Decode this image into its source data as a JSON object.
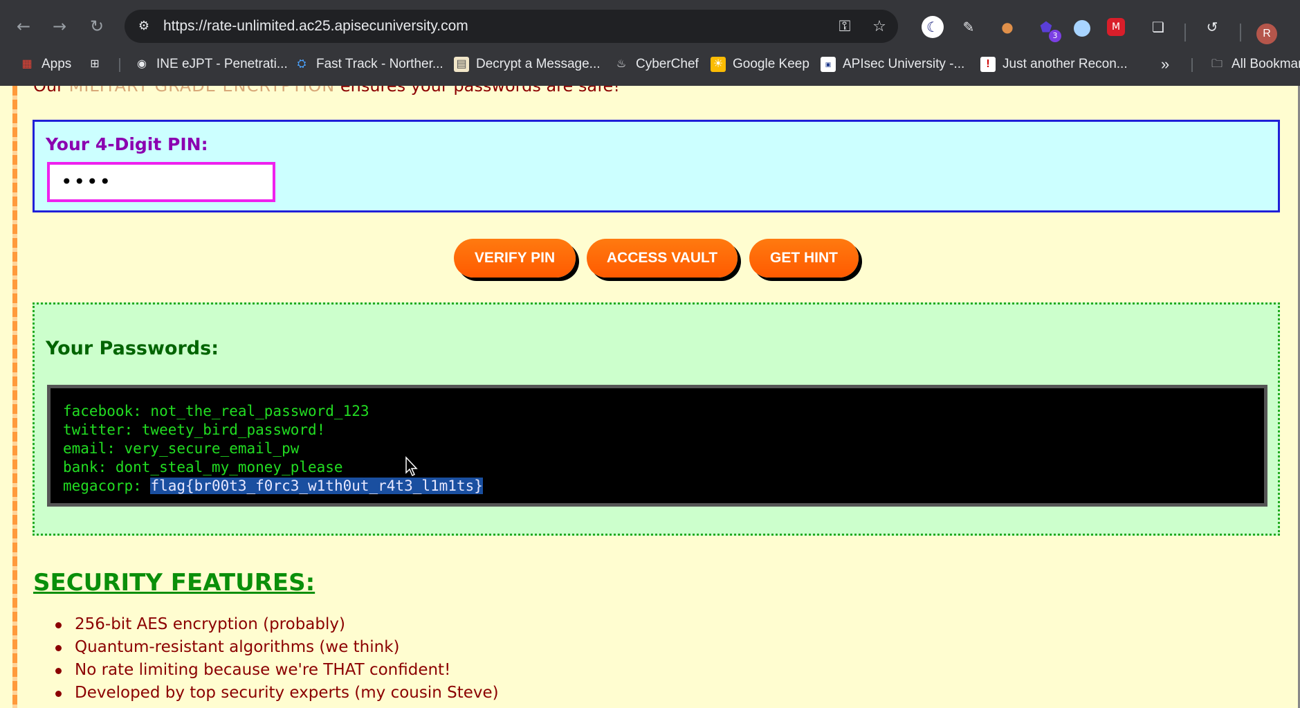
{
  "browser": {
    "url": "https://rate-unlimited.ac25.apisecuniversity.com",
    "extension_badge": "3",
    "avatar_letter": "R",
    "bookmarks": [
      {
        "label": "Apps",
        "icon": "apps-grid-icon"
      },
      {
        "label": "INE eJPT - Penetrati...",
        "icon": "globe-icon"
      },
      {
        "label": "Fast Track - Norther...",
        "icon": "gear-icon"
      },
      {
        "label": "Decrypt a Message...",
        "icon": "document-icon"
      },
      {
        "label": "CyberChef",
        "icon": "chef-hat-icon"
      },
      {
        "label": "Google Keep",
        "icon": "keep-icon"
      },
      {
        "label": "APIsec University -...",
        "icon": "apisec-icon"
      },
      {
        "label": "Just another Recon...",
        "icon": "exclamation-icon"
      }
    ],
    "all_bookmarks": "All Bookmar"
  },
  "page": {
    "intro_prefix": "Our ",
    "intro_highlight": "MILITARY GRADE ENCRYPTION",
    "intro_suffix": " ensures your passwords are safe!",
    "pin_label": "Your 4-Digit PIN:",
    "pin_value": "••••",
    "buttons": {
      "verify": "VERIFY PIN",
      "vault": "ACCESS VAULT",
      "hint": "GET HINT"
    },
    "passwords_title": "Your Passwords:",
    "passwords": [
      "facebook: not_the_real_password_123",
      "twitter: tweety_bird_password!",
      "email: very_secure_email_pw",
      "bank: dont_steal_my_money_please"
    ],
    "megacorp_label": "megacorp: ",
    "megacorp_value": "flag{br00t3_f0rc3_w1th0ut_r4t3_l1m1ts}",
    "security_title": "SECURITY FEATURES:",
    "features": [
      "256-bit AES encryption (probably)",
      "Quantum-resistant algorithms (we think)",
      "No rate limiting because we're THAT confident!",
      "Developed by top security experts (my cousin Steve)"
    ]
  },
  "colors": {
    "page_bg": "#fffdd0",
    "accent_orange": "#ff6a00",
    "pin_panel": "#ccffff",
    "password_panel": "#ccffcc",
    "terminal_text": "#22dd22"
  }
}
